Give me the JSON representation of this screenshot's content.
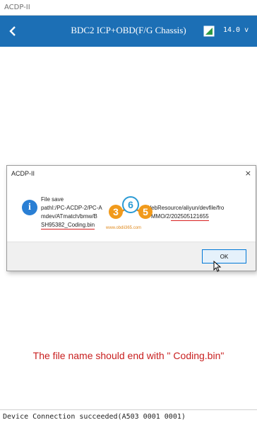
{
  "window": {
    "title": "ACDP-II"
  },
  "header": {
    "title": "BDC2 ICP+OBD(F/G Chassis)",
    "voltage": "14.0 v"
  },
  "icons": {
    "back": "chevron-left-icon",
    "battery": "battery-icon",
    "info": "info-icon",
    "close": "close-icon"
  },
  "colors": {
    "header": "#1c6fb5",
    "accent_red": "#c81e1e",
    "info_blue": "#2a7fd4"
  },
  "dialog": {
    "title": "ACDP-II",
    "close_symbol": "×",
    "message_title": "File save",
    "path_line1": "pathI:/PC-ACDP-2/PC-A",
    "path_line1_tail": "WebResource/aliyun/devfile/fro",
    "path_line2_a": "mdev/ATmatch/bmw/B",
    "path_line2_b": "MMO/2/",
    "path_line2_c": "202505121655",
    "path_line3_a": "SH95382_",
    "path_line3_b": "Coding.bin",
    "ok_label": "OK"
  },
  "watermark": {
    "text": "365",
    "url": "www.obdii365.com"
  },
  "caption": {
    "text": "The file name should end with \" Coding.bin\""
  },
  "status": {
    "text": "Device Connection succeeded(A503 0001 0001)"
  }
}
